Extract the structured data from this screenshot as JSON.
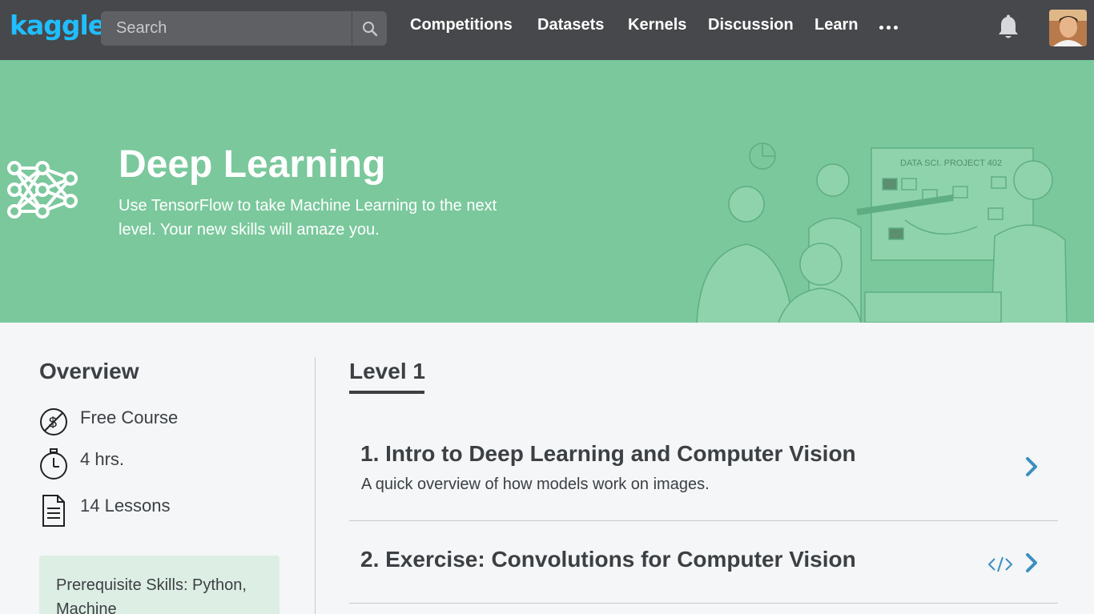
{
  "header": {
    "logo": "kaggle",
    "search_placeholder": "Search",
    "nav": [
      "Competitions",
      "Datasets",
      "Kernels",
      "Discussion",
      "Learn"
    ]
  },
  "hero": {
    "title": "Deep Learning",
    "subtitle": "Use TensorFlow to take Machine Learning to the next level. Your new skills will amaze you.",
    "illustration_board_text": "DATA SCI. PROJECT 402"
  },
  "overview": {
    "title": "Overview",
    "items": [
      {
        "icon": "free-course-icon",
        "label": "Free Course"
      },
      {
        "icon": "stopwatch-icon",
        "label": "4 hrs."
      },
      {
        "icon": "document-icon",
        "label": "14 Lessons"
      }
    ],
    "prereq_text": "Prerequisite Skills: Python, Machine"
  },
  "level": {
    "tab_label": "Level 1"
  },
  "lessons": [
    {
      "title": "1. Intro to Deep Learning and Computer Vision",
      "description": "A quick overview of how models work on images."
    },
    {
      "title": "2. Exercise: Convolutions for Computer Vision",
      "description": ""
    }
  ],
  "colors": {
    "nav_bg": "#47484b",
    "logo": "#20beff",
    "hero_bg": "#7ac89c",
    "accent_blue": "#3d8ec0",
    "prereq_bg": "#ddeee4"
  }
}
